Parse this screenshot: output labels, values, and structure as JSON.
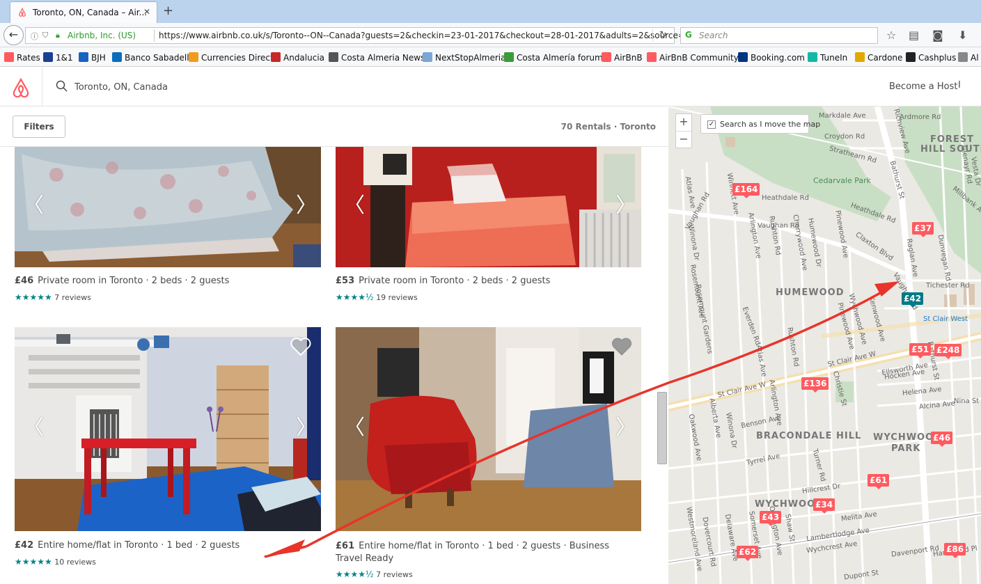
{
  "browser": {
    "tab_title": "Toronto, ON, Canada – Air...",
    "tab_close": "✕",
    "new_tab": "+",
    "back": "←",
    "site_identity": "Airbnb, Inc. (US)",
    "url": "https://www.airbnb.co.uk/s/Toronto--ON--Canada?guests=2&checkin=23-01-2017&checkout=28-01-2017&adults=2&source=bb&pag",
    "reload": "↻",
    "search_placeholder": "Search",
    "bookmarks": [
      {
        "label": "Rates",
        "color": "#ff5a5f"
      },
      {
        "label": "1&1",
        "color": "#1c3f94"
      },
      {
        "label": "BJH",
        "color": "#1565c0"
      },
      {
        "label": "Banco Sabadell",
        "color": "#0a6ebd"
      },
      {
        "label": "Currencies Direct",
        "color": "#f29b1d"
      },
      {
        "label": "Andalucia",
        "color": "#c62828"
      },
      {
        "label": "Costa Almeria News",
        "color": "#555555"
      },
      {
        "label": "NextStopAlmeria",
        "color": "#7aa7d6"
      },
      {
        "label": "Costa Almería forum",
        "color": "#3b9a3b"
      },
      {
        "label": "AirBnB",
        "color": "#ff5a5f"
      },
      {
        "label": "AirBnB Community",
        "color": "#ff5a5f"
      },
      {
        "label": "Booking.com",
        "color": "#003580"
      },
      {
        "label": "TuneIn",
        "color": "#14b8a6"
      },
      {
        "label": "Cardone",
        "color": "#e0a800"
      },
      {
        "label": "Cashplus",
        "color": "#222222"
      },
      {
        "label": "Al",
        "color": "#888888"
      }
    ]
  },
  "header": {
    "location": "Toronto, ON, Canada",
    "become_host": "Become a Host",
    "more": "I"
  },
  "toolbar": {
    "filters_label": "Filters",
    "rentals_count": "70 Rentals · Toronto"
  },
  "listings": [
    {
      "price": "£46",
      "desc": "Private room in Toronto · 2 beds · 2 guests",
      "stars": "★★★★★",
      "reviews": "7 reviews"
    },
    {
      "price": "£53",
      "desc": "Private room in Toronto · 2 beds · 2 guests",
      "stars": "★★★★½",
      "reviews": "19 reviews"
    },
    {
      "price": "£42",
      "desc": "Entire home/flat in Toronto · 1 bed · 2 guests",
      "stars": "★★★★★",
      "reviews": "10 reviews"
    },
    {
      "price": "£61",
      "desc": "Entire home/flat in Toronto · 1 bed · 2 guests · Business Travel Ready",
      "stars": "★★★★½",
      "reviews": "7 reviews"
    }
  ],
  "map": {
    "zoom_in": "+",
    "zoom_out": "−",
    "search_move_label": "Search as I move the map",
    "search_move_checked": "✓",
    "areas": [
      "FOREST",
      "HILL SOUTH",
      "HUMEWOOD",
      "BRACONDALE HILL",
      "WYCHWOO",
      "PARK",
      "WYCHWOO"
    ],
    "parks": [
      "Cedarvale Park"
    ],
    "station": "St Clair West",
    "pins": [
      "£164",
      "£37",
      "£42",
      "£51",
      "£248",
      "£136",
      "£46",
      "£61",
      "£34",
      "£43",
      "£62",
      "£86"
    ],
    "roads": [
      "Markdale Ave",
      "Croydon Rd",
      "Strathearn Rd",
      "Ardmore Rd",
      "Richview Ave",
      "Glenayr Rd",
      "Vesta Dr",
      "Millbank Ave",
      "Heathdale Rd",
      "Heathdale Rd",
      "Atlas Ave",
      "Winnett Ave",
      "Vaughan Rd",
      "Winona Dr",
      "Vaughan Rd",
      "Arlington Ave",
      "Rushton Rd",
      "Cherrywood Ave",
      "Humewood Dr",
      "Pinewood Ave",
      "Claxton Blvd",
      "Bathurst St",
      "Raglan Ave",
      "Dunvegan Rd",
      "Tichester Rd",
      "Rosemount Ave",
      "Rosemount Gardens",
      "Wychwood Ave",
      "Kenwood Ave",
      "Everden Rd",
      "Pinewood Ave",
      "St Clair Ave W",
      "St Clair Ave W",
      "Ellsworth Ave",
      "Hocken Ave",
      "Helena Ave",
      "Alcina Ave",
      "Nina St",
      "Christie St",
      "Benson Ave",
      "Tyrrel Ave",
      "Turner Rd",
      "Hillcrest Dr",
      "Melita Ave",
      "Lambertlodge Ave",
      "Wychcrest Ave",
      "Oakwood Ave",
      "Alberta Ave",
      "Winona Dr",
      "Arlington Ave",
      "Westmoreland Ave",
      "Dovercourt Rd",
      "Delaware Ave",
      "Somerset Ave",
      "Ossington Ave",
      "Shaw St",
      "Dupont St",
      "Hammond Pl",
      "Davenport Rd",
      "Atlas Ave",
      "Rushton Rd",
      "Bathurst St",
      "Vaughan Rd"
    ]
  }
}
